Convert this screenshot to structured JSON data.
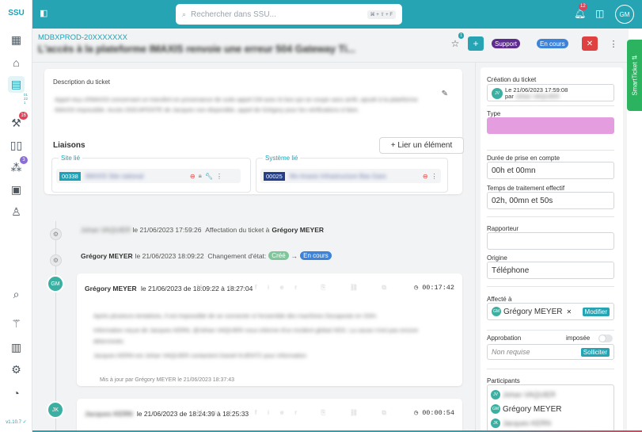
{
  "app": {
    "logo": "SSU",
    "version": "v1.10.7 ✓"
  },
  "search": {
    "placeholder": "Rechercher dans SSU...",
    "shortcut": "⌘ + ⇧ + F"
  },
  "topbar": {
    "notifications_count": "12",
    "avatar_initials": "GM"
  },
  "rail": {
    "badges": {
      "tickets": "16",
      "groups": "3"
    },
    "tickets_mini": [
      "01",
      "22",
      "1"
    ]
  },
  "header": {
    "ref": "MDBXPROD-20XXXXXXX",
    "title": "L'accès à la plateforme IMAXIS renvoie une erreur 504 Gateway Ti...",
    "star_count": "1",
    "plus_label": "+",
    "support_label": "Support",
    "status_label": "En cours",
    "close_label": "✕",
    "more_label": "⋮"
  },
  "smart_ticket": {
    "label": "SmartTicket ⇅"
  },
  "description": {
    "label": "Description du ticket",
    "text": "Appel reçu d'IMAXIS concernant un transfert en provenance de suite appel CM avec le box qui se coupe sans arrêt, ajouté à la plateforme IMAXIS impossible. Accès DOCAPOSTE de Jacques non disponible, appel de Grégory pour les vérifications à faire."
  },
  "liaisons": {
    "title": "Liaisons",
    "link_button": "+  Lier un élément",
    "site": {
      "legend": "Site lié",
      "code": "00338",
      "name": "IMAXIS Site national"
    },
    "system": {
      "legend": "Système lié",
      "code": "00025",
      "name": "Mx-Imaxis Infrastructure Bas Gare"
    }
  },
  "timeline": {
    "event1": {
      "author": "Johan VAQUIER",
      "date": "le 21/06/2023 17:59:26",
      "action": "Affectation du ticket à",
      "target": "Grégory MEYER"
    },
    "event2": {
      "author": "Grégory MEYER",
      "date": "le 21/06/2023 18:09:22",
      "action": "Changement d'état:",
      "from": "Créé",
      "arrow": "→",
      "to": "En cours"
    },
    "comment1": {
      "initials": "GM",
      "author": "Grégory MEYER",
      "date": "le 21/06/2023 de 18:09:22 à 18:27:04",
      "timer": "00:17:42",
      "tools": "Modifier ⎘ ⛓ ⧉",
      "body1": "Après plusieurs tentatives, il est impossible de se connecter à l'ensemble des machines Docaposte en SSH.",
      "body2": "Information reçue de Jacques KERN, @Johan VAQUIER nous informe d'un incident global HDS. La cause n'est pas encore déterminée.",
      "body3": "Jacques KERN est Johan VAQUIER contactent Daniel KUENTZ pour information",
      "updated": "Mis à jour par Grégory MEYER le 21/06/2023 18:37:43"
    },
    "comment2": {
      "initials": "JK",
      "author": "Jacques KERN",
      "date": "le 21/06/2023 de 18:24:39 à 18:25:33",
      "timer": "00:00:54"
    }
  },
  "right_panel": {
    "creation_label": "Création du ticket",
    "creation_initials": "JV",
    "creation_date": "Le 21/06/2023 17:59:08",
    "creation_by": "par",
    "creation_author": "Johan VAQUIER",
    "type_label": "Type",
    "duration_label": "Durée de prise en compte",
    "duration_value": "00h et 00mn",
    "processing_label": "Temps de traitement effectif",
    "processing_value": "02h, 00mn et 50s",
    "reporter_label": "Rapporteur",
    "origin_label": "Origine",
    "origin_value": "Téléphone",
    "assigned_label": "Affecté à",
    "assigned_initials": "GM",
    "assigned_value": "Grégory MEYER",
    "assigned_remove": "✕",
    "assigned_modify": "Modifier",
    "approval_label": "Approbation",
    "imposed_label": "imposée",
    "approval_value": "Non requise",
    "request_label": "Solliciter",
    "participants_label": "Participants",
    "participants": [
      {
        "initials": "JV",
        "name": "Johan VAQUIER"
      },
      {
        "initials": "GM",
        "name": "Grégory MEYER"
      },
      {
        "initials": "JK",
        "name": "Jacques KERN"
      }
    ]
  },
  "colors": {
    "accent": "#26a4b4",
    "support": "#5e2c8c",
    "status": "#3d84d8",
    "danger": "#e04040",
    "type_fill": "#e49ee0",
    "state_created": "#7fc79a"
  }
}
